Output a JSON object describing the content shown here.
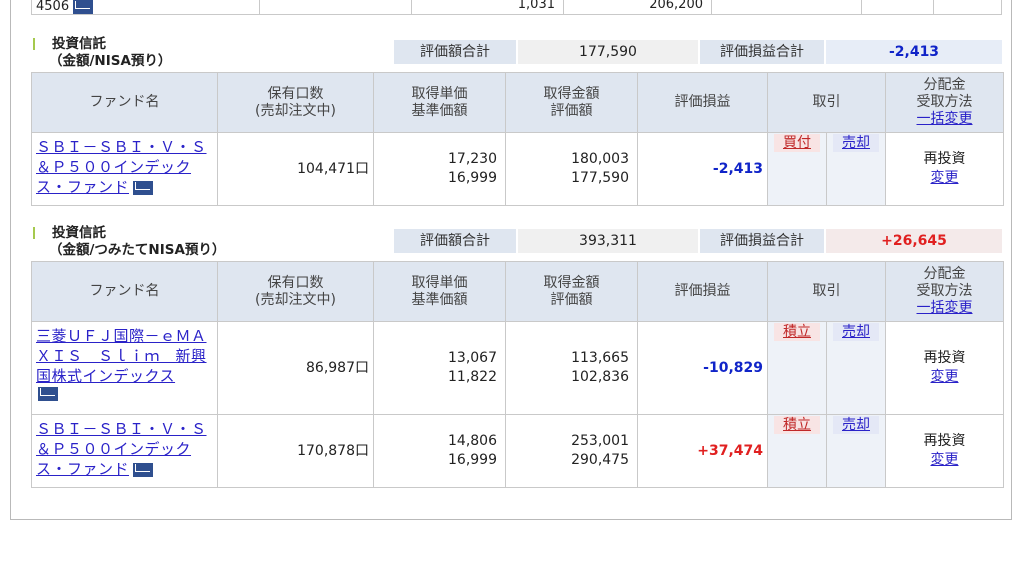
{
  "top_row": {
    "code": "4506",
    "qty": "1,031",
    "amount": "206,200"
  },
  "colors": {
    "negative": "#1024c8",
    "positive": "#e02020",
    "header_bg": "#dfe6f0",
    "link": "#2a22c8"
  },
  "headers": {
    "fund": "ファンド名",
    "holding_1": "保有口数",
    "holding_2": "(売却注文中)",
    "unit_1": "取得単価",
    "unit_2": "基準価額",
    "amount_1": "取得金額",
    "amount_2": "評価額",
    "pl": "評価損益",
    "trade": "取引",
    "dist_1": "分配金",
    "dist_2": "受取方法",
    "dist_3": "一括変更"
  },
  "sections": [
    {
      "title_1": "投資信託",
      "title_2": "（金額/NISA預り）",
      "sum_label": "評価額合計",
      "sum_value": "177,590",
      "pl_label": "評価損益合計",
      "pl_value": "-2,413",
      "rows": [
        {
          "fund": "ＳＢＩ－ＳＢＩ・Ｖ・Ｓ＆Ｐ５００インデックス・ファンド",
          "fund_l1": "ＳＢＩ－ＳＢＩ・Ｖ・Ｓ",
          "fund_l2": "＆Ｐ５００インデック",
          "fund_l3": "ス・ファンド",
          "qty": "104,471口",
          "unit_cost": "17,230",
          "nav": "16,999",
          "cost": "180,003",
          "value": "177,590",
          "pl": "-2,413",
          "buy": "買付",
          "sell": "売却",
          "dist": "再投資",
          "dist_link": "変更"
        }
      ]
    },
    {
      "title_1": "投資信託",
      "title_2": "（金額/つみたてNISA預り）",
      "sum_label": "評価額合計",
      "sum_value": "393,311",
      "pl_label": "評価損益合計",
      "pl_value": "+26,645",
      "rows": [
        {
          "fund_l1": "三菱ＵＦＪ国際－ｅＭＡ",
          "fund_l2": "ＸＩＳ　Ｓｌｉｍ　新興",
          "fund_l3": "国株式インデックス",
          "qty": "86,987口",
          "unit_cost": "13,067",
          "nav": "11,822",
          "cost": "113,665",
          "value": "102,836",
          "pl": "-10,829",
          "buy": "積立",
          "sell": "売却",
          "dist": "再投資",
          "dist_link": "変更"
        },
        {
          "fund_l1": "ＳＢＩ－ＳＢＩ・Ｖ・Ｓ",
          "fund_l2": "＆Ｐ５００インデック",
          "fund_l3": "ス・ファンド",
          "qty": "170,878口",
          "unit_cost": "14,806",
          "nav": "16,999",
          "cost": "253,001",
          "value": "290,475",
          "pl": "+37,474",
          "buy": "積立",
          "sell": "売却",
          "dist": "再投資",
          "dist_link": "変更"
        }
      ]
    }
  ]
}
